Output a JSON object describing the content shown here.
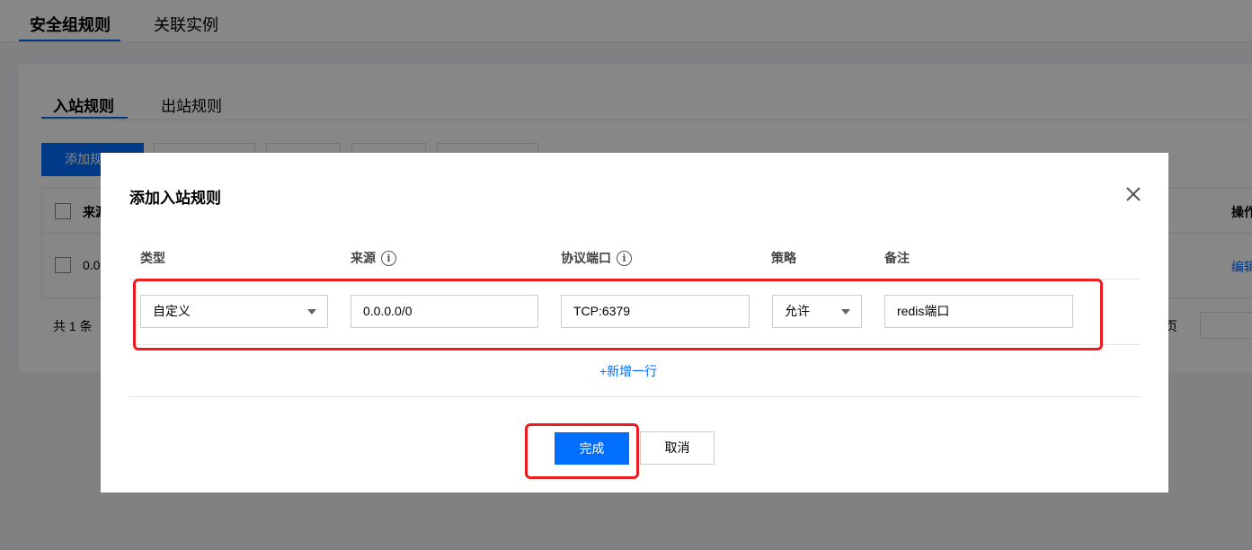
{
  "top_tabs": [
    {
      "label": "安全组规则",
      "active": true
    },
    {
      "label": "关联实例",
      "active": false
    }
  ],
  "inner_tabs": [
    {
      "label": "入站规则",
      "active": true
    },
    {
      "label": "出站规则",
      "active": false
    }
  ],
  "background": {
    "add_rule_button": "添加规",
    "table_header_source": "来源",
    "table_header_ops": "操作",
    "row_source": "0.0",
    "row_edit": "编辑",
    "pagination_total": "共 1 条",
    "pagination_page": "页"
  },
  "dialog": {
    "title": "添加入站规则",
    "columns": {
      "type": "类型",
      "source": "来源",
      "protocol_port": "协议端口",
      "policy": "策略",
      "remark": "备注"
    },
    "row": {
      "type": "自定义",
      "source": "0.0.0.0/0",
      "protocol_port": "TCP:6379",
      "policy": "允许",
      "remark": "redis端口"
    },
    "add_row_label": "+新增一行",
    "done_label": "完成",
    "cancel_label": "取消"
  },
  "colors": {
    "primary": "#006eff",
    "highlight": "#ee1c1c"
  }
}
